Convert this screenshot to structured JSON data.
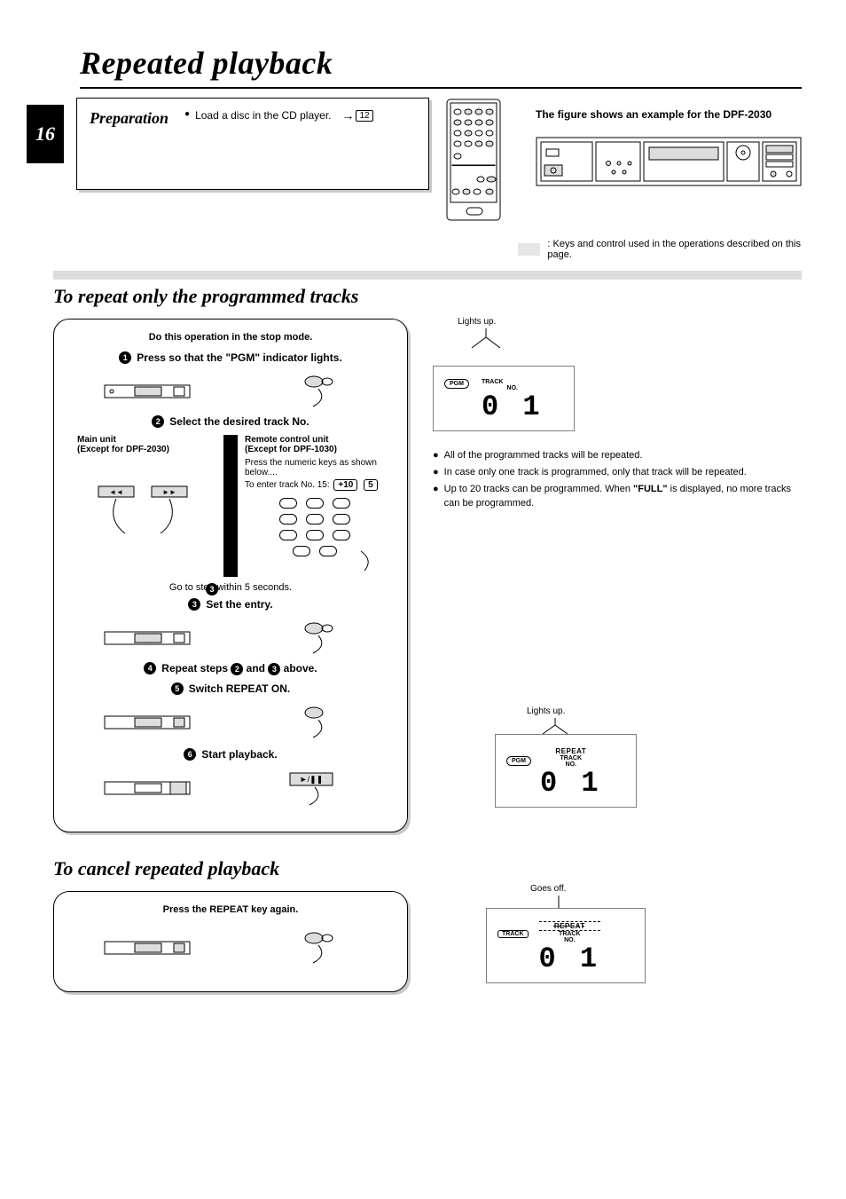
{
  "page": {
    "title": "Repeated playback",
    "number": "16"
  },
  "preparation": {
    "label": "Preparation",
    "text": "Load a disc in the CD player.",
    "page_ref": "12"
  },
  "figure_caption": "The figure shows an example for the DPF-2030",
  "legend_text": ": Keys and control used in the operations described on this page.",
  "section1": {
    "heading": "To repeat only the programmed tracks",
    "precondition": "Do this operation in the stop mode.",
    "step1_label": "Press so that the \"PGM\" indicator lights.",
    "step2_label": "Select the desired track No.",
    "main_unit_title": "Main unit",
    "main_unit_sub": "(Except for DPF-2030)",
    "remote_title": "Remote control unit",
    "remote_sub": "(Except for DPF-1030)",
    "remote_instr1": "Press the numeric keys as shown below....",
    "remote_instr2_prefix": "To enter track No. 15:",
    "remote_key_a": "+10",
    "remote_key_b": "5",
    "goto3": "Go to step        within 5 seconds.",
    "goto3_num": "3",
    "step3_label": "Set the entry.",
    "step4_label_prefix": "Repeat steps ",
    "step4_label_mid": " and ",
    "step4_label_suffix": " above.",
    "step4_ref_a": "2",
    "step4_ref_b": "3",
    "step5_label": "Switch REPEAT ON.",
    "step6_label": "Start playback.",
    "display1_caption": "Lights up.",
    "display1_pgm": "PGM",
    "display1_trackno_a": "TRACK",
    "display1_trackno_b": "NO.",
    "display1_value": "0 1",
    "notes": [
      "All of the programmed tracks will be repeated.",
      "In case only one track is programmed, only that track  will be repeated.",
      "Up to 20 tracks can be programmed. When \"FULL\" is displayed, no more tracks can be programmed."
    ],
    "note_full_word": "\"FULL\"",
    "display2_caption": "Lights up.",
    "display2_pgm": "PGM",
    "display2_repeat": "REPEAT",
    "display2_track": "TRACK",
    "display2_no": "NO.",
    "display2_value": "0 1"
  },
  "section2": {
    "heading": "To cancel repeated playback",
    "instruction": "Press the REPEAT key again.",
    "display_caption": "Goes off.",
    "display_track": "TRACK",
    "display_repeat": "REPEAT",
    "display_tracklbl": "TRACK",
    "display_no": "NO.",
    "display_value": "0 1"
  }
}
